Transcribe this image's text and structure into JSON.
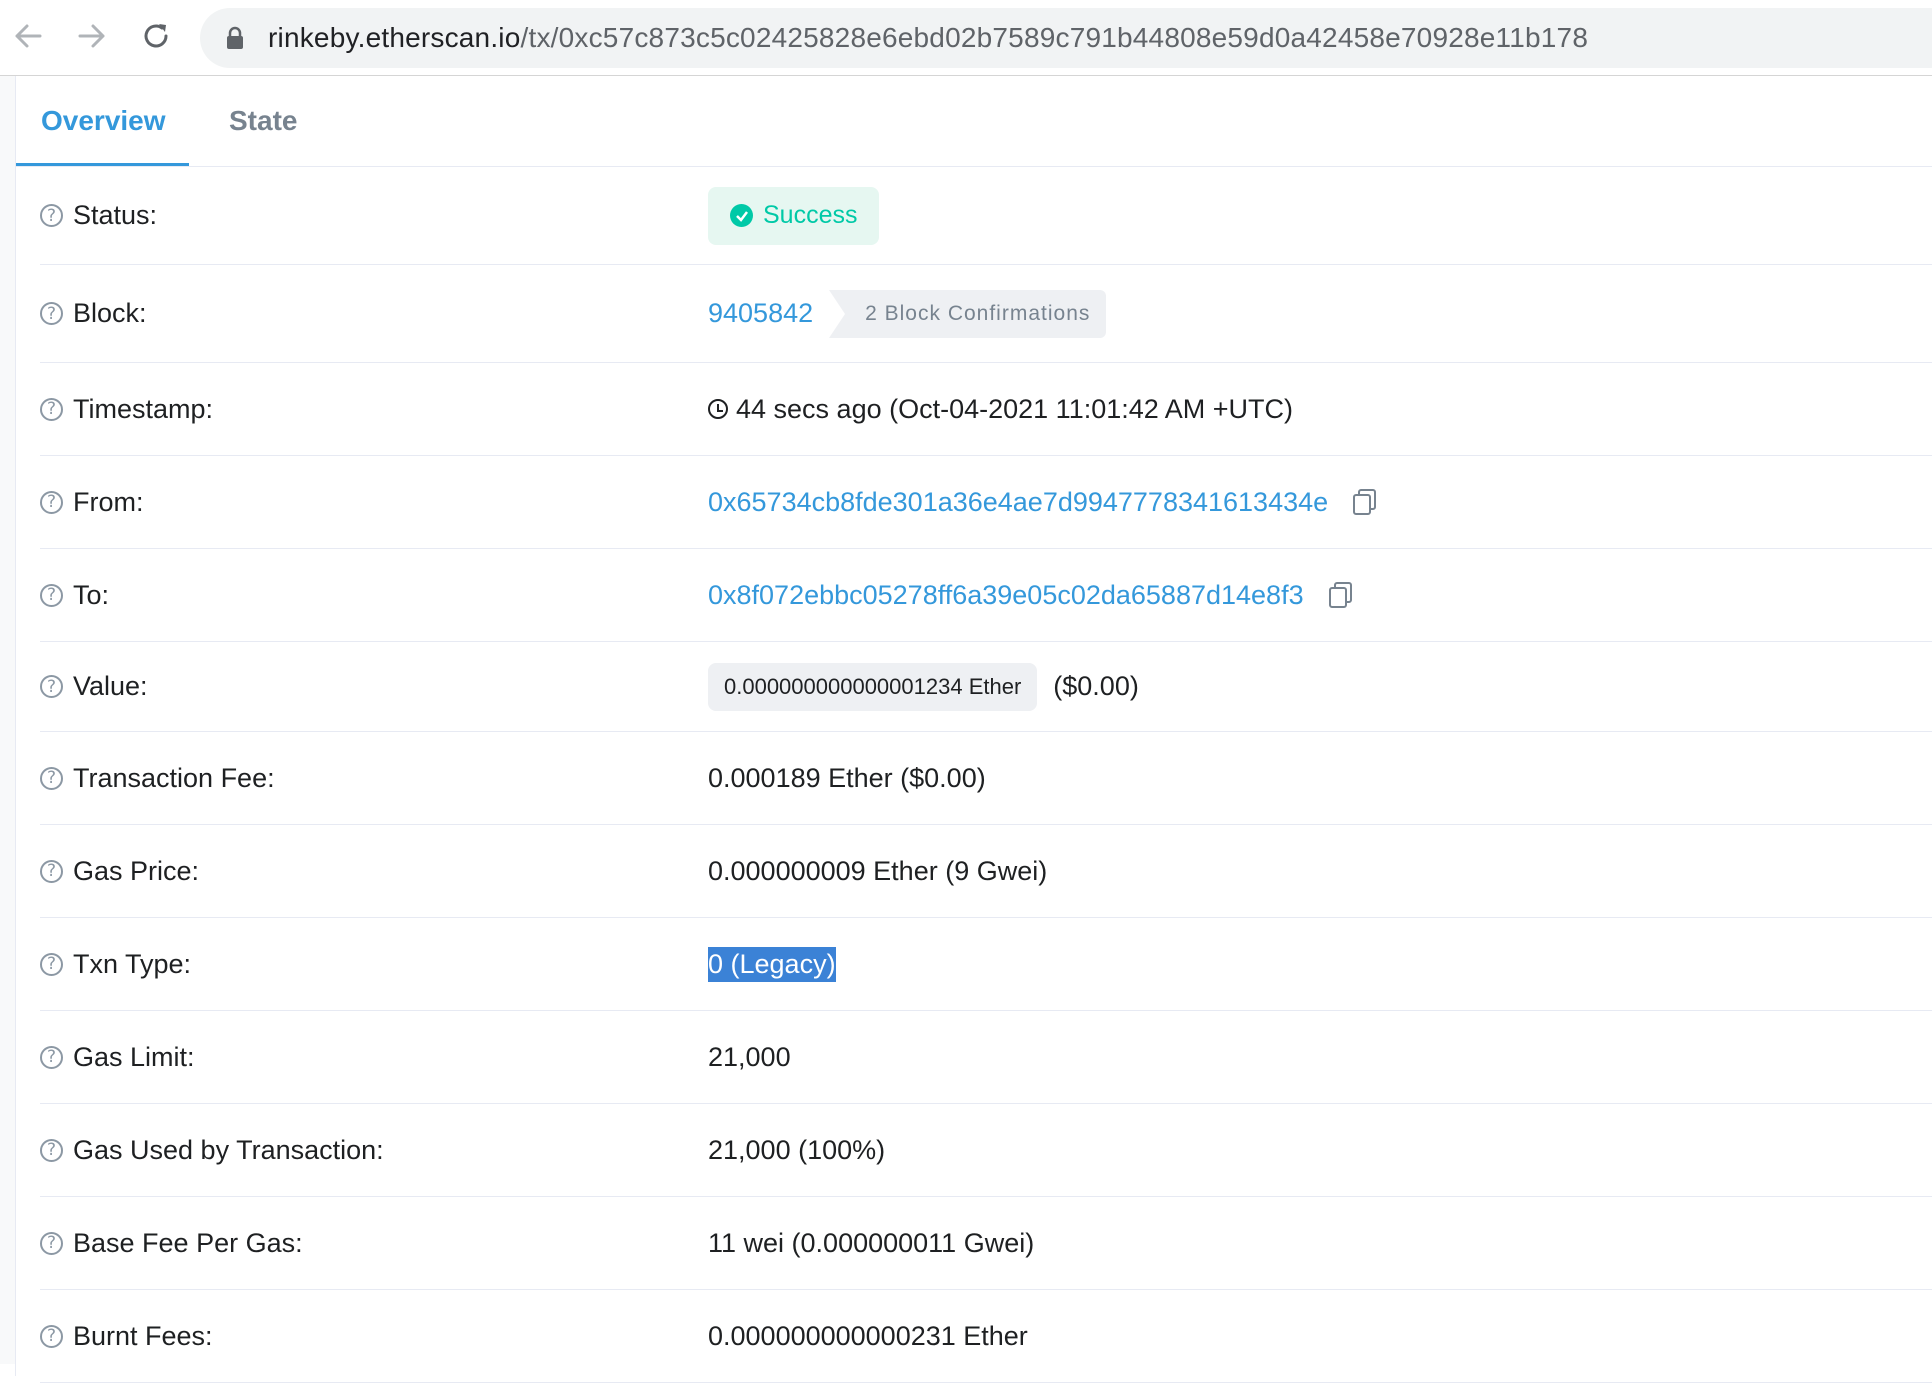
{
  "browser": {
    "url_host": "rinkeby.etherscan.io",
    "url_path": "/tx/0xc57c873c5c02425828e6ebd02b7589c791b44808e59d0a42458e70928e11b178",
    "icons": {
      "back": "arrow-left-icon",
      "forward": "arrow-right-icon",
      "reload": "reload-icon",
      "lock": "lock-icon"
    }
  },
  "tabs": [
    {
      "label": "Overview",
      "active": true
    },
    {
      "label": "State",
      "active": false
    }
  ],
  "colors": {
    "accent": "#3498db",
    "success": "#00c9a7",
    "selection": "#3b82d6"
  },
  "rows": {
    "status": {
      "label": "Status:",
      "value": "Success"
    },
    "block": {
      "label": "Block:",
      "value": "9405842",
      "confirmations": "2 Block Confirmations"
    },
    "timestamp": {
      "label": "Timestamp:",
      "value": "44 secs ago (Oct-04-2021 11:01:42 AM +UTC)"
    },
    "from": {
      "label": "From:",
      "value": "0x65734cb8fde301a36e4ae7d9947778341613434e"
    },
    "to": {
      "label": "To:",
      "value": "0x8f072ebbc05278ff6a39e05c02da65887d14e8f3"
    },
    "value": {
      "label": "Value:",
      "amount": "0.000000000000001234 Ether",
      "usd": "($0.00)"
    },
    "fee": {
      "label": "Transaction Fee:",
      "value": "0.000189 Ether ($0.00)"
    },
    "gas_price": {
      "label": "Gas Price:",
      "value": "0.000000009 Ether (9 Gwei)"
    },
    "txn_type": {
      "label": "Txn Type:",
      "value": "0 (Legacy)"
    },
    "gas_limit": {
      "label": "Gas Limit:",
      "value": "21,000"
    },
    "gas_used": {
      "label": "Gas Used by Transaction:",
      "value": "21,000 (100%)"
    },
    "base_fee": {
      "label": "Base Fee Per Gas:",
      "value": "11 wei (0.000000011 Gwei)"
    },
    "burnt_fees": {
      "label": "Burnt Fees:",
      "value": "0.000000000000231 Ether"
    }
  }
}
